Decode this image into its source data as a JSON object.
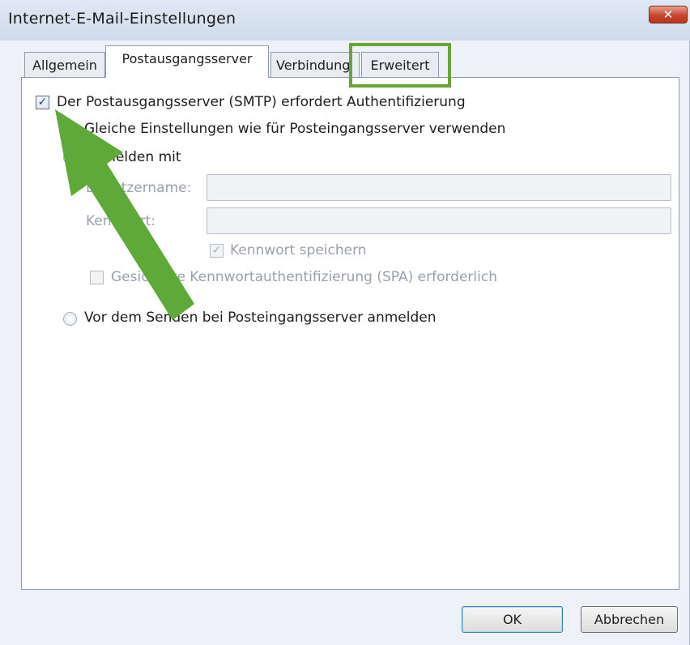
{
  "window": {
    "title": "Internet-E-Mail-Einstellungen",
    "close_symbol": "✕"
  },
  "tabs": [
    {
      "label": "Allgemein"
    },
    {
      "label": "Postausgangsserver",
      "active": true
    },
    {
      "label": "Verbindung"
    },
    {
      "label": "Erweitert",
      "highlighted": true
    }
  ],
  "smtp_auth": {
    "checkbox_label": "Der Postausgangsserver (SMTP) erfordert Authentifizierung",
    "checked": true,
    "option_same_settings": "Gleiche Einstellungen wie für Posteingangsserver verwenden",
    "option_login_with": "Anmelden mit",
    "username_label": "Benutzername:",
    "username_value": "",
    "password_label": "Kennwort:",
    "password_value": "",
    "save_password_label": "Kennwort speichern",
    "save_password_checked": true,
    "spa_label": "Gesicherte Kennwortauthentifizierung (SPA) erforderlich",
    "spa_checked": false,
    "option_login_before_send": "Vor dem Senden bei Posteingangsserver anmelden"
  },
  "buttons": {
    "ok": "OK",
    "cancel": "Abbrechen"
  },
  "annotation": {
    "arrow_color": "#5fa83a",
    "highlight_color": "#6aa437"
  },
  "check_symbol": "✓"
}
